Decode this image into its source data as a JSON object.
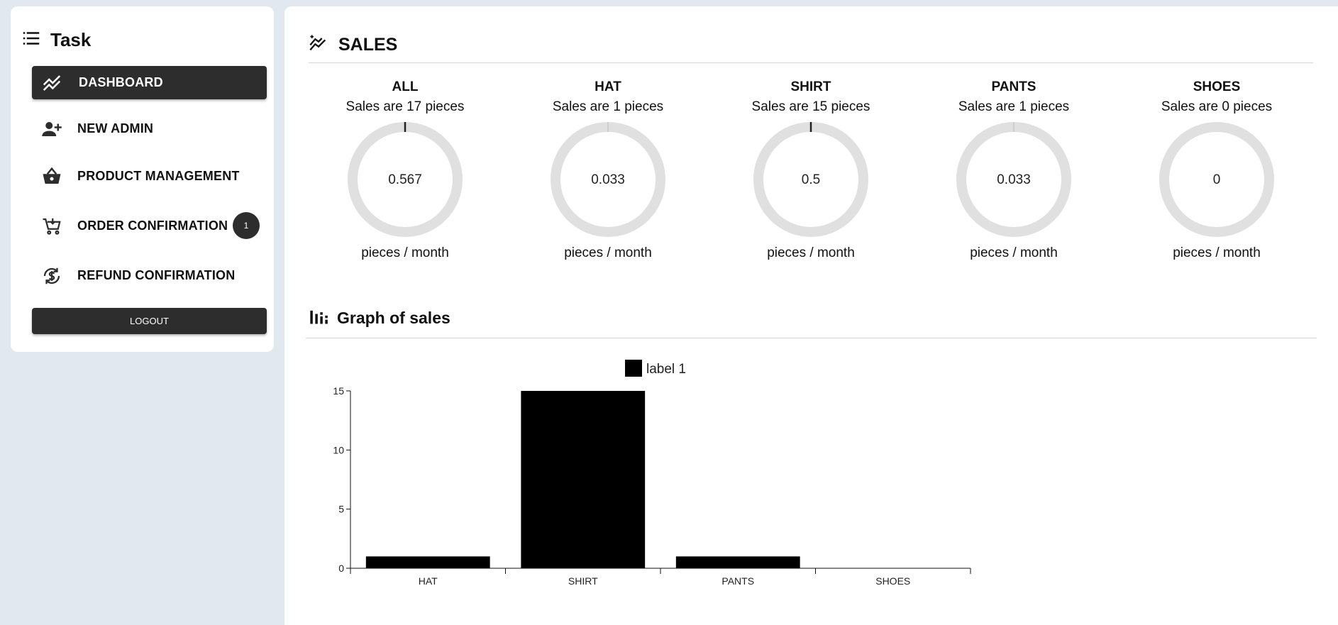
{
  "sidebar": {
    "title": "Task",
    "menu_icon": "list-icon",
    "items": [
      {
        "label": "DASHBOARD",
        "icon": "trending-icon",
        "active": true
      },
      {
        "label": "NEW ADMIN",
        "icon": "person-add-icon"
      },
      {
        "label": "PRODUCT MANAGEMENT",
        "icon": "basket-icon"
      },
      {
        "label": "ORDER CONFIRMATION",
        "icon": "cart-icon",
        "badge": "1"
      },
      {
        "label": "REFUND CONFIRMATION",
        "icon": "refund-icon"
      }
    ],
    "logout_label": "LOGOUT"
  },
  "sales": {
    "title": "SALES",
    "gauges": [
      {
        "name": "ALL",
        "subtitle": "Sales are 17 pieces",
        "value": "0.567",
        "fraction": 0.567,
        "unit": "pieces / month"
      },
      {
        "name": "HAT",
        "subtitle": "Sales are 1 pieces",
        "value": "0.033",
        "fraction": 0.033,
        "unit": "pieces / month"
      },
      {
        "name": "SHIRT",
        "subtitle": "Sales are 15 pieces",
        "value": "0.5",
        "fraction": 0.5,
        "unit": "pieces / month"
      },
      {
        "name": "PANTS",
        "subtitle": "Sales are 1 pieces",
        "value": "0.033",
        "fraction": 0.033,
        "unit": "pieces / month"
      },
      {
        "name": "SHOES",
        "subtitle": "Sales are 0 pieces",
        "value": "0",
        "fraction": 0,
        "unit": "pieces / month"
      }
    ]
  },
  "graph": {
    "title": "Graph of sales"
  },
  "chart_data": {
    "type": "bar",
    "categories": [
      "HAT",
      "SHIRT",
      "PANTS",
      "SHOES"
    ],
    "series": [
      {
        "name": "label 1",
        "values": [
          1,
          15,
          1,
          0
        ]
      }
    ],
    "ylim": [
      0,
      15
    ],
    "yticks": [
      0,
      5,
      10,
      15
    ],
    "legend": "top",
    "bar_color": "#000000",
    "grid": false
  }
}
